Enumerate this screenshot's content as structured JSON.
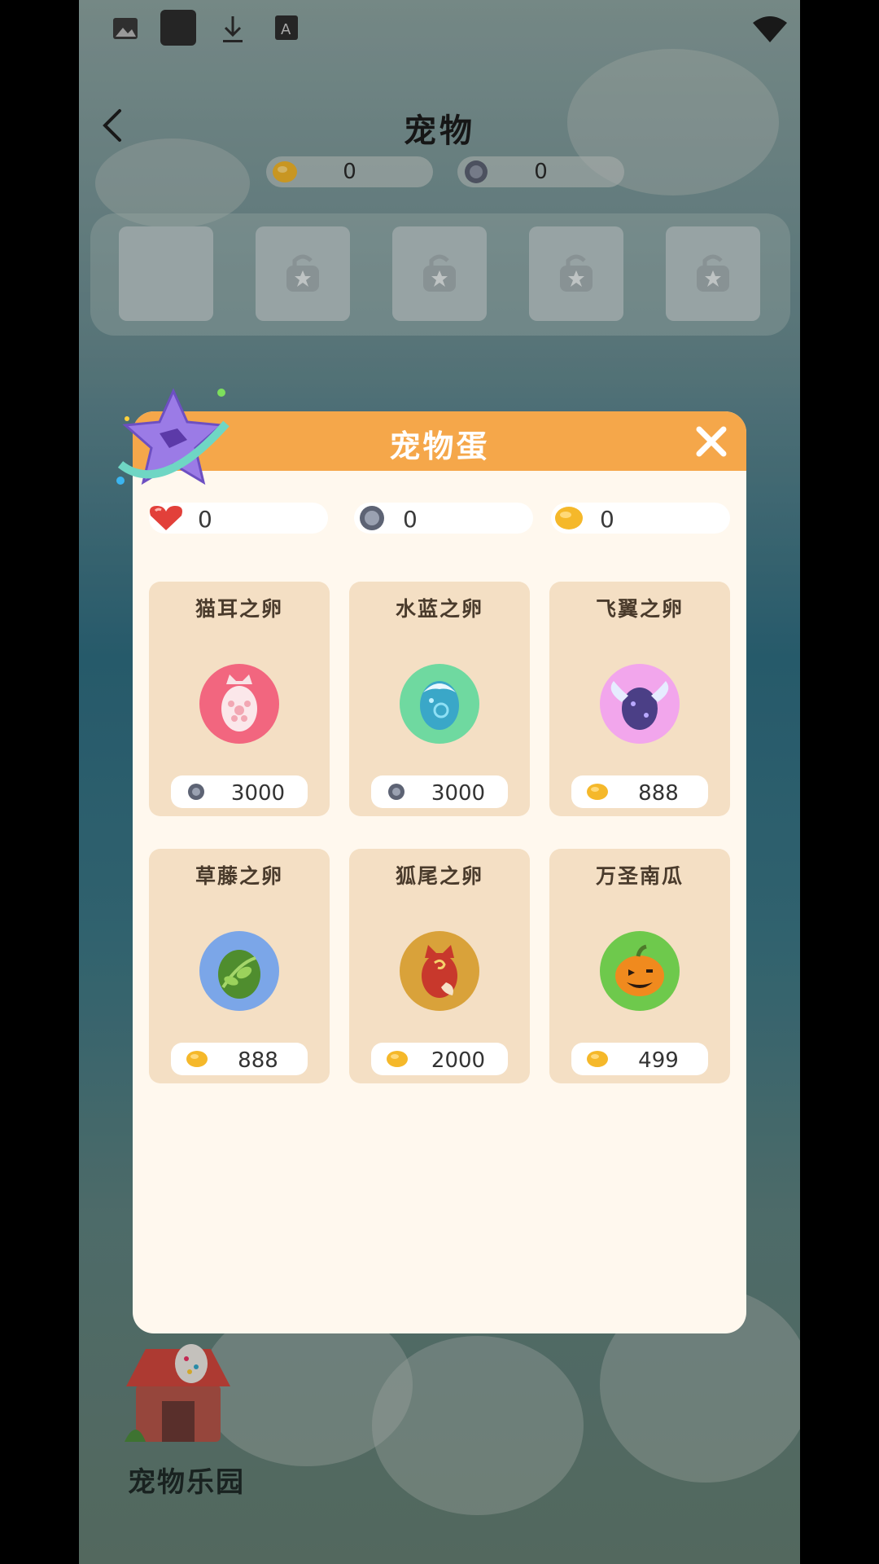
{
  "colors": {
    "header_orange": "#f5a74a",
    "dialog_bg": "#fff8ee",
    "card_bg": "#f4dfc4",
    "gold_coin": "#f5b82a",
    "silver_coin": "#6e7584"
  },
  "topbar": {
    "title": "宠物",
    "back_icon": "chevron-left-icon",
    "currencies": [
      {
        "icon": "gold-bean-icon",
        "value": "0"
      },
      {
        "icon": "silver-coin-icon",
        "value": "0"
      }
    ]
  },
  "slots": [
    {
      "state": "empty"
    },
    {
      "state": "locked",
      "icon": "lock-star-icon"
    },
    {
      "state": "locked",
      "icon": "lock-star-icon"
    },
    {
      "state": "locked",
      "icon": "lock-star-icon"
    },
    {
      "state": "locked",
      "icon": "lock-star-icon"
    }
  ],
  "park": {
    "label": "宠物乐园",
    "icon": "pet-shop-icon"
  },
  "dialog": {
    "title": "宠物蛋",
    "close_icon": "close-icon",
    "stats": [
      {
        "icon": "heart-icon",
        "value": "0"
      },
      {
        "icon": "silver-coin-icon",
        "value": "0"
      },
      {
        "icon": "gold-bean-icon",
        "value": "0"
      }
    ],
    "eggs": [
      {
        "name": "猫耳之卵",
        "icon": "cat-ear-egg-icon",
        "currency": "silver-coin-icon",
        "price": "3000"
      },
      {
        "name": "水蓝之卵",
        "icon": "water-blue-egg-icon",
        "currency": "silver-coin-icon",
        "price": "3000"
      },
      {
        "name": "飞翼之卵",
        "icon": "winged-egg-icon",
        "currency": "gold-bean-icon",
        "price": "888"
      },
      {
        "name": "草藤之卵",
        "icon": "vine-egg-icon",
        "currency": "gold-bean-icon",
        "price": "888"
      },
      {
        "name": "狐尾之卵",
        "icon": "fox-tail-egg-icon",
        "currency": "gold-bean-icon",
        "price": "2000"
      },
      {
        "name": "万圣南瓜",
        "icon": "pumpkin-icon",
        "currency": "gold-bean-icon",
        "price": "499"
      }
    ]
  }
}
